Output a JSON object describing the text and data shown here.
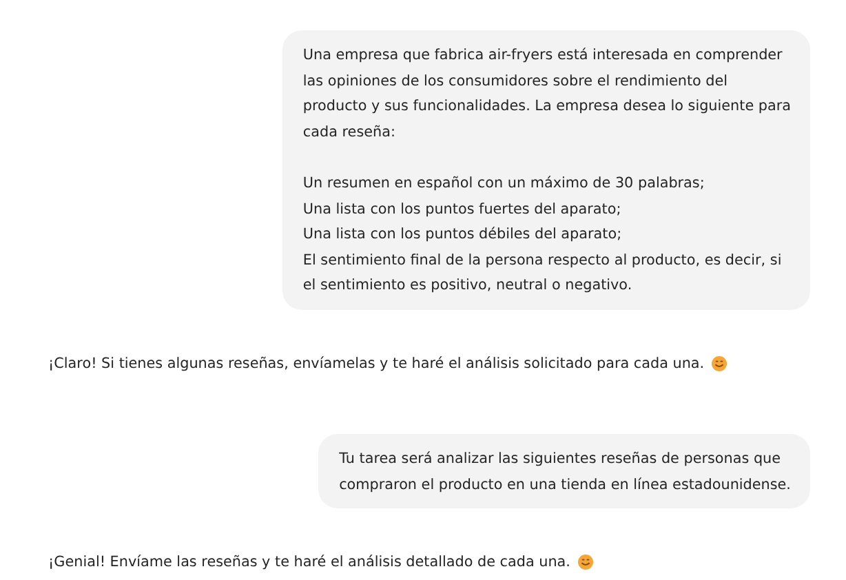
{
  "messages": [
    {
      "kind": "user",
      "text": "Una empresa que fabrica air-fryers está interesada en comprender\nlas opiniones de los consumidores sobre el rendimiento del\nproducto y sus funcionalidades. La empresa desea lo siguiente para\ncada reseña:\n\nUn resumen en español con un máximo de 30 palabras;\nUna lista con los puntos fuertes del aparato;\nUna lista con los puntos débiles del aparato;\nEl sentimiento final de la persona respecto al producto, es decir, si\nel sentimiento es positivo, neutral o negativo."
    },
    {
      "kind": "assistant",
      "text": "¡Claro! Si tienes algunas reseñas, envíamelas y te haré el análisis solicitado para cada una."
    },
    {
      "kind": "user",
      "text": "Tu tarea será analizar las siguientes reseñas de personas que\ncompraron el producto en una tienda en línea estadounidense."
    },
    {
      "kind": "assistant",
      "text": "¡Genial! Envíame las reseñas y te haré el análisis detallado de cada una."
    }
  ]
}
